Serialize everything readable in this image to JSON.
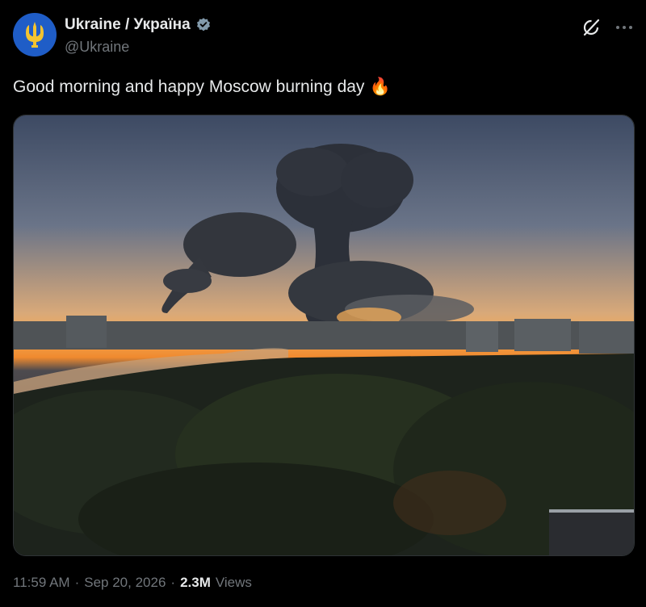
{
  "account": {
    "display_name": "Ukraine / Україна",
    "handle": "@Ukraine",
    "verified": true
  },
  "post": {
    "text": "Good morning and happy Moscow burning day",
    "emoji": "🔥"
  },
  "media": {
    "description_icon": "photo"
  },
  "meta": {
    "time": "11:59 AM",
    "sep1": "·",
    "date": "Sep 20, 2026",
    "sep2": "·",
    "views_count": "2.3M",
    "views_label": "Views"
  },
  "colors": {
    "background": "#000000",
    "text": "#e7e9ea",
    "secondary_text": "#71767b",
    "verified_badge": "#829aab",
    "avatar_bg": "#1f5dc7"
  },
  "icons": {
    "avatar": "ukraine-trident-icon",
    "verified": "verified-badge-icon",
    "grok": "grok-icon",
    "more": "more-options-icon"
  }
}
